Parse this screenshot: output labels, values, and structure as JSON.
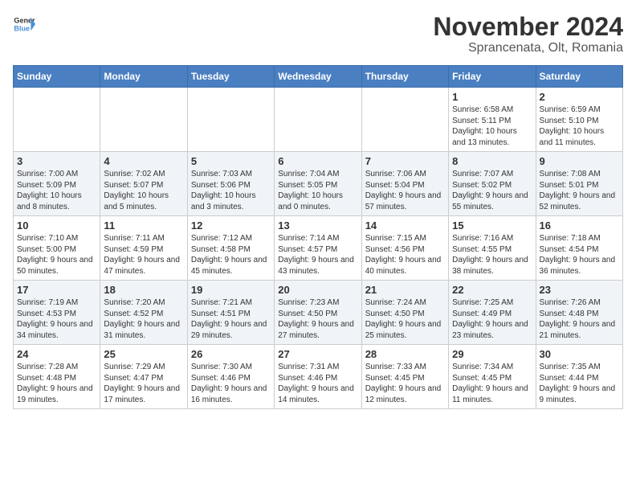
{
  "header": {
    "logo_general": "General",
    "logo_blue": "Blue",
    "title": "November 2024",
    "subtitle": "Sprancenata, Olt, Romania"
  },
  "days_of_week": [
    "Sunday",
    "Monday",
    "Tuesday",
    "Wednesday",
    "Thursday",
    "Friday",
    "Saturday"
  ],
  "weeks": [
    [
      {
        "day": "",
        "info": ""
      },
      {
        "day": "",
        "info": ""
      },
      {
        "day": "",
        "info": ""
      },
      {
        "day": "",
        "info": ""
      },
      {
        "day": "",
        "info": ""
      },
      {
        "day": "1",
        "info": "Sunrise: 6:58 AM\nSunset: 5:11 PM\nDaylight: 10 hours and 13 minutes."
      },
      {
        "day": "2",
        "info": "Sunrise: 6:59 AM\nSunset: 5:10 PM\nDaylight: 10 hours and 11 minutes."
      }
    ],
    [
      {
        "day": "3",
        "info": "Sunrise: 7:00 AM\nSunset: 5:09 PM\nDaylight: 10 hours and 8 minutes."
      },
      {
        "day": "4",
        "info": "Sunrise: 7:02 AM\nSunset: 5:07 PM\nDaylight: 10 hours and 5 minutes."
      },
      {
        "day": "5",
        "info": "Sunrise: 7:03 AM\nSunset: 5:06 PM\nDaylight: 10 hours and 3 minutes."
      },
      {
        "day": "6",
        "info": "Sunrise: 7:04 AM\nSunset: 5:05 PM\nDaylight: 10 hours and 0 minutes."
      },
      {
        "day": "7",
        "info": "Sunrise: 7:06 AM\nSunset: 5:04 PM\nDaylight: 9 hours and 57 minutes."
      },
      {
        "day": "8",
        "info": "Sunrise: 7:07 AM\nSunset: 5:02 PM\nDaylight: 9 hours and 55 minutes."
      },
      {
        "day": "9",
        "info": "Sunrise: 7:08 AM\nSunset: 5:01 PM\nDaylight: 9 hours and 52 minutes."
      }
    ],
    [
      {
        "day": "10",
        "info": "Sunrise: 7:10 AM\nSunset: 5:00 PM\nDaylight: 9 hours and 50 minutes."
      },
      {
        "day": "11",
        "info": "Sunrise: 7:11 AM\nSunset: 4:59 PM\nDaylight: 9 hours and 47 minutes."
      },
      {
        "day": "12",
        "info": "Sunrise: 7:12 AM\nSunset: 4:58 PM\nDaylight: 9 hours and 45 minutes."
      },
      {
        "day": "13",
        "info": "Sunrise: 7:14 AM\nSunset: 4:57 PM\nDaylight: 9 hours and 43 minutes."
      },
      {
        "day": "14",
        "info": "Sunrise: 7:15 AM\nSunset: 4:56 PM\nDaylight: 9 hours and 40 minutes."
      },
      {
        "day": "15",
        "info": "Sunrise: 7:16 AM\nSunset: 4:55 PM\nDaylight: 9 hours and 38 minutes."
      },
      {
        "day": "16",
        "info": "Sunrise: 7:18 AM\nSunset: 4:54 PM\nDaylight: 9 hours and 36 minutes."
      }
    ],
    [
      {
        "day": "17",
        "info": "Sunrise: 7:19 AM\nSunset: 4:53 PM\nDaylight: 9 hours and 34 minutes."
      },
      {
        "day": "18",
        "info": "Sunrise: 7:20 AM\nSunset: 4:52 PM\nDaylight: 9 hours and 31 minutes."
      },
      {
        "day": "19",
        "info": "Sunrise: 7:21 AM\nSunset: 4:51 PM\nDaylight: 9 hours and 29 minutes."
      },
      {
        "day": "20",
        "info": "Sunrise: 7:23 AM\nSunset: 4:50 PM\nDaylight: 9 hours and 27 minutes."
      },
      {
        "day": "21",
        "info": "Sunrise: 7:24 AM\nSunset: 4:50 PM\nDaylight: 9 hours and 25 minutes."
      },
      {
        "day": "22",
        "info": "Sunrise: 7:25 AM\nSunset: 4:49 PM\nDaylight: 9 hours and 23 minutes."
      },
      {
        "day": "23",
        "info": "Sunrise: 7:26 AM\nSunset: 4:48 PM\nDaylight: 9 hours and 21 minutes."
      }
    ],
    [
      {
        "day": "24",
        "info": "Sunrise: 7:28 AM\nSunset: 4:48 PM\nDaylight: 9 hours and 19 minutes."
      },
      {
        "day": "25",
        "info": "Sunrise: 7:29 AM\nSunset: 4:47 PM\nDaylight: 9 hours and 17 minutes."
      },
      {
        "day": "26",
        "info": "Sunrise: 7:30 AM\nSunset: 4:46 PM\nDaylight: 9 hours and 16 minutes."
      },
      {
        "day": "27",
        "info": "Sunrise: 7:31 AM\nSunset: 4:46 PM\nDaylight: 9 hours and 14 minutes."
      },
      {
        "day": "28",
        "info": "Sunrise: 7:33 AM\nSunset: 4:45 PM\nDaylight: 9 hours and 12 minutes."
      },
      {
        "day": "29",
        "info": "Sunrise: 7:34 AM\nSunset: 4:45 PM\nDaylight: 9 hours and 11 minutes."
      },
      {
        "day": "30",
        "info": "Sunrise: 7:35 AM\nSunset: 4:44 PM\nDaylight: 9 hours and 9 minutes."
      }
    ]
  ]
}
